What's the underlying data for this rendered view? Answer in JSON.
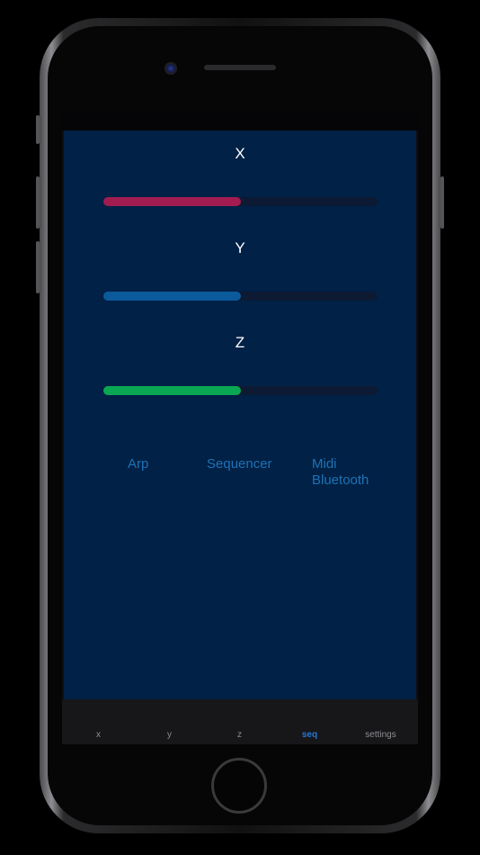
{
  "sliders": [
    {
      "label": "X",
      "value": 0.5,
      "color": "#a21c51"
    },
    {
      "label": "Y",
      "value": 0.5,
      "color": "#0a5a9c"
    },
    {
      "label": "Z",
      "value": 0.5,
      "color": "#0aa852"
    }
  ],
  "modes": {
    "arp": "Arp",
    "sequencer": "Sequencer",
    "midi_line1": "Midi",
    "midi_line2": "Bluetooth"
  },
  "tabs": [
    {
      "label": "x",
      "active": false
    },
    {
      "label": "y",
      "active": false
    },
    {
      "label": "z",
      "active": false
    },
    {
      "label": "seq",
      "active": true
    },
    {
      "label": "settings",
      "active": false
    }
  ],
  "colors": {
    "background": "#012146",
    "link": "#1f72b5",
    "tab_active": "#2477d6",
    "tab_inactive": "#8e8e93"
  }
}
